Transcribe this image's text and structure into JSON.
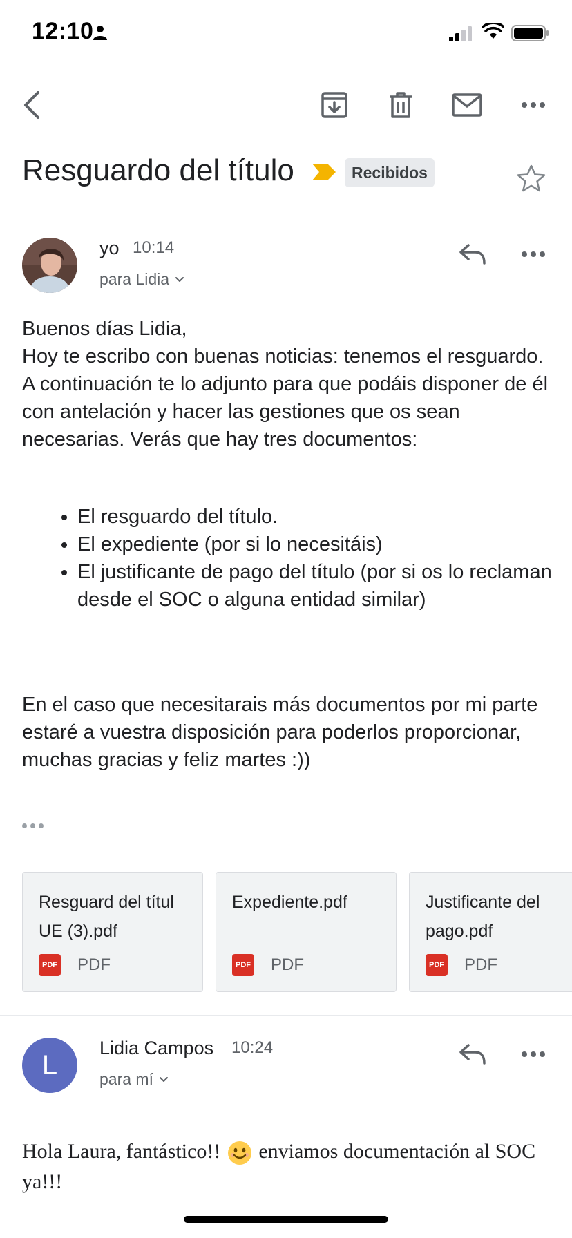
{
  "status_bar": {
    "time": "12:10"
  },
  "subject": {
    "title": "Resguardo del título",
    "label": "Recibidos"
  },
  "messages": [
    {
      "sender": "yo",
      "time": "10:14",
      "recipient": "para Lidia",
      "greeting": "Buenos días Lidia,",
      "paragraph1": "Hoy te escribo con buenas noticias: tenemos el resguardo. A continuación te lo adjunto para que podáis disponer de él con antelación y hacer las gestiones que os sean necesarias. Verás que hay tres documentos:",
      "bullets": [
        "El resguardo del título.",
        "El expediente (por si lo necesitáis)",
        "El justificante de pago del título (por si os lo reclaman desde el SOC o alguna entidad similar)"
      ],
      "paragraph2": "En el caso que necesitarais más documentos por mi parte estaré a vuestra disposición para poderlos proporcionar,",
      "closing": "muchas gracias y feliz martes :))",
      "attachments": [
        {
          "name": "Resguard del títul UE (3).pdf",
          "type": "PDF"
        },
        {
          "name": "Expediente.pdf",
          "type": "PDF"
        },
        {
          "name": "Justificante del pago.pdf",
          "type": "PDF"
        }
      ],
      "pdf_badge": "PDF"
    },
    {
      "sender": "Lidia Campos",
      "avatar_letter": "L",
      "time": "10:24",
      "recipient": "para mí",
      "body_part1": "Hola Laura, fantástico!!",
      "body_part2": "enviamos documentación al SOC ya!!!"
    }
  ],
  "colors": {
    "label_arrow": "#f4b400",
    "avatar_letter_bg": "#5c6bc0",
    "pdf_icon": "#d93025"
  }
}
